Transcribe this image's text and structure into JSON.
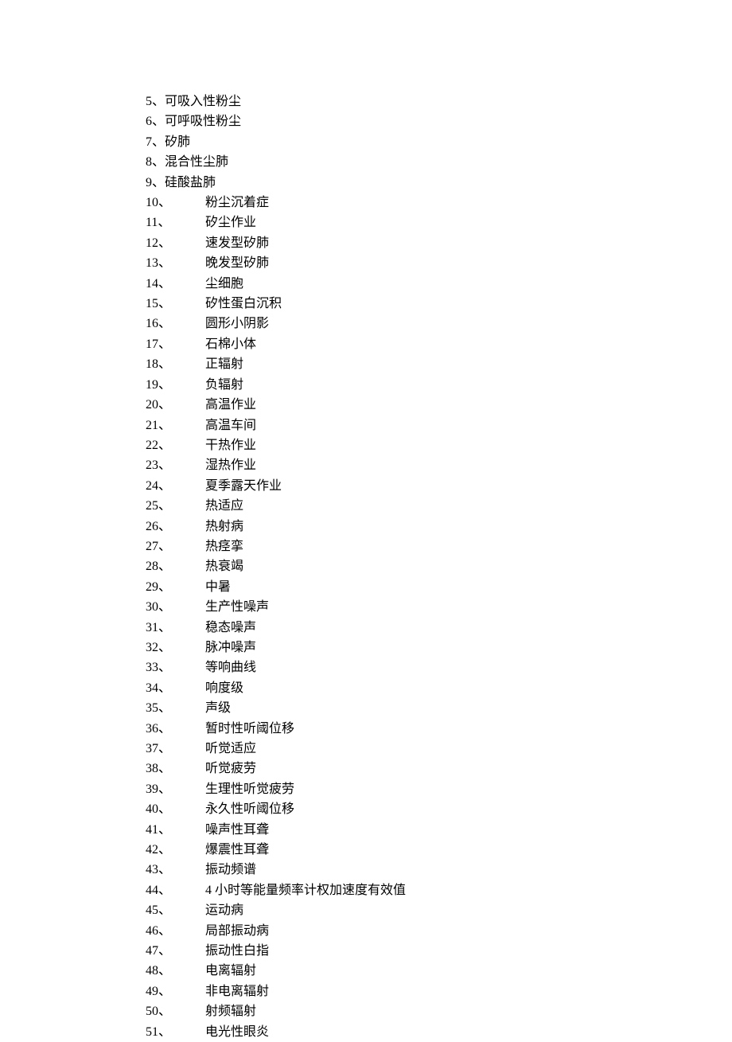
{
  "items": [
    {
      "num": "5",
      "term": "可吸入性粉尘",
      "wide": false
    },
    {
      "num": "6",
      "term": "可呼吸性粉尘",
      "wide": false
    },
    {
      "num": "7",
      "term": "矽肺",
      "wide": false
    },
    {
      "num": "8",
      "term": "混合性尘肺",
      "wide": false
    },
    {
      "num": "9",
      "term": "硅酸盐肺",
      "wide": false
    },
    {
      "num": "10",
      "term": "粉尘沉着症",
      "wide": true
    },
    {
      "num": "11",
      "term": "矽尘作业",
      "wide": true
    },
    {
      "num": "12",
      "term": "速发型矽肺",
      "wide": true
    },
    {
      "num": "13",
      "term": "晚发型矽肺",
      "wide": true
    },
    {
      "num": "14",
      "term": "尘细胞",
      "wide": true
    },
    {
      "num": "15",
      "term": "矽性蛋白沉积",
      "wide": true
    },
    {
      "num": "16",
      "term": "圆形小阴影",
      "wide": true
    },
    {
      "num": "17",
      "term": "石棉小体",
      "wide": true
    },
    {
      "num": "18",
      "term": "正辐射",
      "wide": true
    },
    {
      "num": "19",
      "term": "负辐射",
      "wide": true
    },
    {
      "num": "20",
      "term": "高温作业",
      "wide": true
    },
    {
      "num": "21",
      "term": "高温车间",
      "wide": true
    },
    {
      "num": "22",
      "term": "干热作业",
      "wide": true
    },
    {
      "num": "23",
      "term": "湿热作业",
      "wide": true
    },
    {
      "num": "24",
      "term": "夏季露天作业",
      "wide": true
    },
    {
      "num": "25",
      "term": "热适应",
      "wide": true
    },
    {
      "num": "26",
      "term": "热射病",
      "wide": true
    },
    {
      "num": "27",
      "term": "热痉挛",
      "wide": true
    },
    {
      "num": "28",
      "term": "热衰竭",
      "wide": true
    },
    {
      "num": "29",
      "term": "中暑",
      "wide": true
    },
    {
      "num": "30",
      "term": "生产性噪声",
      "wide": true
    },
    {
      "num": "31",
      "term": "稳态噪声",
      "wide": true
    },
    {
      "num": "32",
      "term": "脉冲噪声",
      "wide": true
    },
    {
      "num": "33",
      "term": "等响曲线",
      "wide": true
    },
    {
      "num": "34",
      "term": "响度级",
      "wide": true
    },
    {
      "num": "35",
      "term": "声级",
      "wide": true
    },
    {
      "num": "36",
      "term": "暂时性听阈位移",
      "wide": true
    },
    {
      "num": "37",
      "term": "听觉适应",
      "wide": true
    },
    {
      "num": "38",
      "term": "听觉疲劳",
      "wide": true
    },
    {
      "num": "39",
      "term": "生理性听觉疲劳",
      "wide": true
    },
    {
      "num": "40",
      "term": "永久性听阈位移",
      "wide": true
    },
    {
      "num": "41",
      "term": "噪声性耳聋",
      "wide": true
    },
    {
      "num": "42",
      "term": "爆震性耳聋",
      "wide": true
    },
    {
      "num": "43",
      "term": "振动频谱",
      "wide": true
    },
    {
      "num": "44",
      "term": "4 小时等能量频率计权加速度有效值",
      "wide": true
    },
    {
      "num": "45",
      "term": "运动病",
      "wide": true
    },
    {
      "num": "46",
      "term": "局部振动病",
      "wide": true
    },
    {
      "num": "47",
      "term": "振动性白指",
      "wide": true
    },
    {
      "num": "48",
      "term": "电离辐射",
      "wide": true
    },
    {
      "num": "49",
      "term": "非电离辐射",
      "wide": true
    },
    {
      "num": "50",
      "term": "射频辐射",
      "wide": true
    },
    {
      "num": "51",
      "term": "电光性眼炎",
      "wide": true
    }
  ]
}
